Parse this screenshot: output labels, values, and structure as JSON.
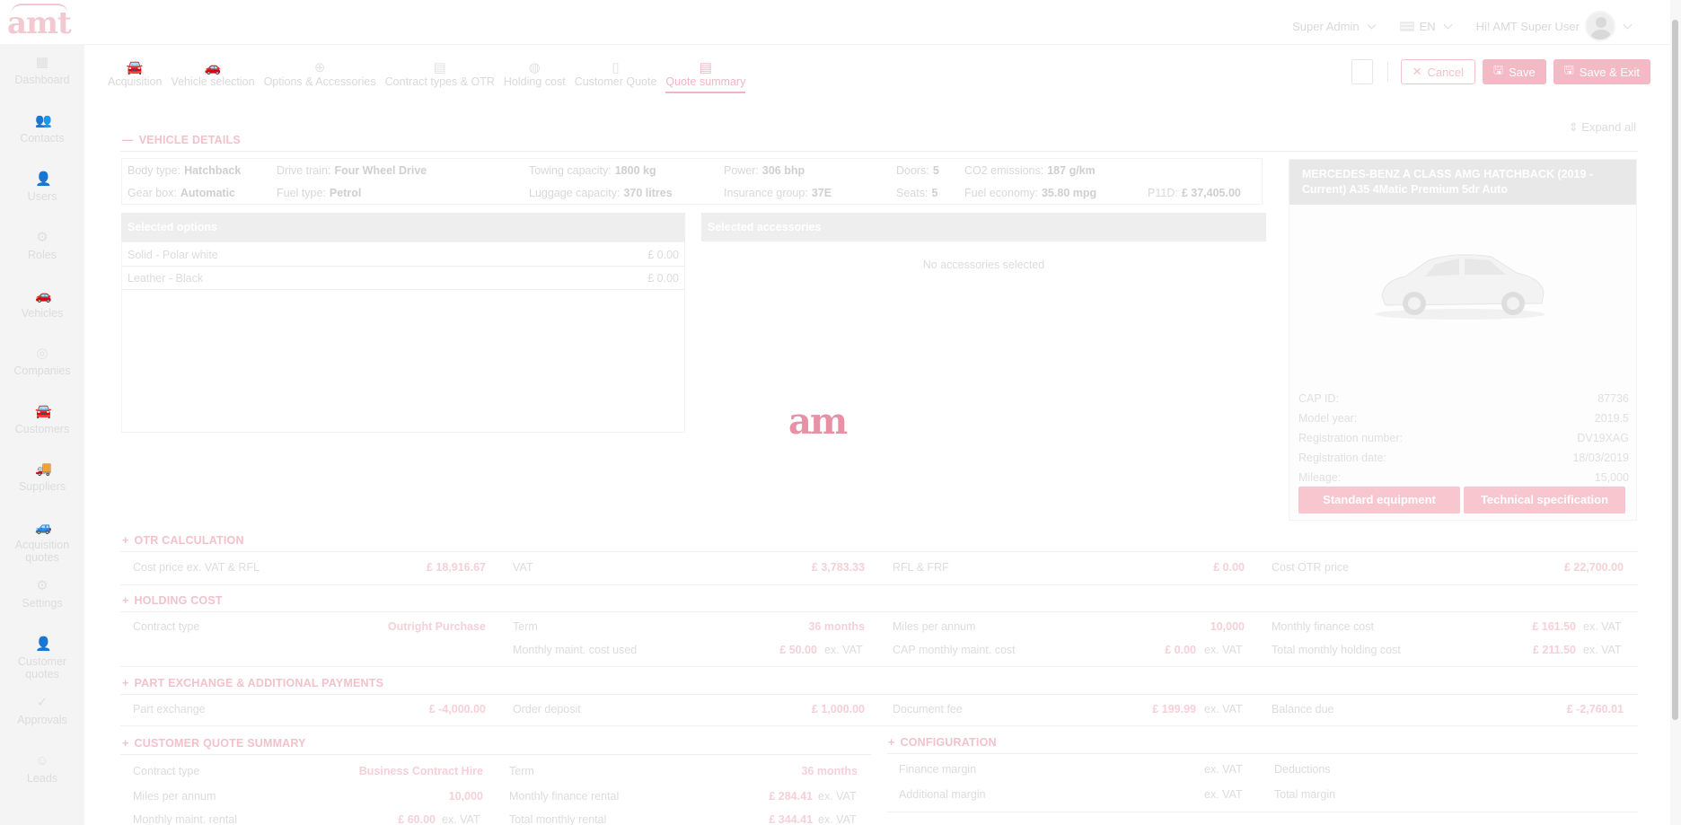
{
  "header": {
    "logo": "amt",
    "role": "Super Admin",
    "language": "EN",
    "greeting": "Hi! AMT Super User"
  },
  "sidebar": [
    {
      "label": "Dashboard",
      "icon": "dashboard-icon",
      "glyph": "▦"
    },
    {
      "label": "Contacts",
      "icon": "contacts-icon",
      "glyph": "👥"
    },
    {
      "label": "Users",
      "icon": "user-icon",
      "glyph": "👤"
    },
    {
      "label": "Roles",
      "icon": "roles-icon",
      "glyph": "⚙"
    },
    {
      "label": "Vehicles",
      "icon": "car-icon",
      "glyph": "🚗"
    },
    {
      "label": "Companies",
      "icon": "companies-icon",
      "glyph": "◎"
    },
    {
      "label": "Customers",
      "icon": "customers-icon",
      "glyph": "🚘"
    },
    {
      "label": "Suppliers",
      "icon": "suppliers-icon",
      "glyph": "🚚"
    },
    {
      "label": "Acquisition quotes",
      "icon": "acquisition-quotes-icon",
      "glyph": "🚙"
    },
    {
      "label": "Settings",
      "icon": "settings-icon",
      "glyph": "⚙"
    },
    {
      "label": "Customer quotes",
      "icon": "customer-quotes-icon",
      "glyph": "👤"
    },
    {
      "label": "Approvals",
      "icon": "approvals-icon",
      "glyph": "✓"
    },
    {
      "label": "Leads",
      "icon": "leads-icon",
      "glyph": "☺"
    }
  ],
  "tabs": [
    {
      "label": "Acquisition",
      "icon": "acquisition-icon",
      "glyph": "🚘"
    },
    {
      "label": "Vehicle selection",
      "icon": "vehicle-selection-icon",
      "glyph": "🚗"
    },
    {
      "label": "Options & Accessories",
      "icon": "options-icon",
      "glyph": "⊕"
    },
    {
      "label": "Contract types & OTR",
      "icon": "contract-icon",
      "glyph": "▤"
    },
    {
      "label": "Holding cost",
      "icon": "holding-cost-icon",
      "glyph": "◍"
    },
    {
      "label": "Customer Quote",
      "icon": "customer-quote-icon",
      "glyph": "▯"
    },
    {
      "label": "Quote summary",
      "icon": "quote-summary-icon",
      "glyph": "▤"
    }
  ],
  "actions": {
    "cancel": "Cancel",
    "save": "Save",
    "save_exit": "Save & Exit"
  },
  "expand_all": "Expand all",
  "vehicle_details": {
    "heading": "VEHICLE DETAILS",
    "specs": {
      "body_type_label": "Body type:",
      "body_type": "Hatchback",
      "drive_train_label": "Drive train:",
      "drive_train": "Four Wheel Drive",
      "towing_label": "Towing capacity:",
      "towing": "1800 kg",
      "power_label": "Power:",
      "power": "306 bhp",
      "doors_label": "Doors:",
      "doors": "5",
      "co2_label": "CO2 emissions:",
      "co2": "187 g/km",
      "gearbox_label": "Gear box:",
      "gearbox": "Automatic",
      "fuel_type_label": "Fuel type:",
      "fuel_type": "Petrol",
      "luggage_label": "Luggage capacity:",
      "luggage": "370 litres",
      "insurance_label": "Insurance group:",
      "insurance": "37E",
      "seats_label": "Seats:",
      "seats": "5",
      "economy_label": "Fuel economy:",
      "economy": "35.80 mpg",
      "p11d_label": "P11D:",
      "p11d": "£ 37,405.00"
    },
    "selected_options": {
      "heading": "Selected options",
      "items": [
        {
          "name": "Solid - Polar white",
          "price": "£ 0.00"
        },
        {
          "name": "Leather - Black",
          "price": "£ 0.00"
        }
      ]
    },
    "selected_accessories": {
      "heading": "Selected accessories",
      "empty": "No accessories selected"
    },
    "car": {
      "title": "MERCEDES-BENZ A CLASS AMG HATCHBACK (2019 - Current) A35 4Matic Premium 5dr Auto",
      "cap_id_label": "CAP ID:",
      "cap_id": "87736",
      "model_year_label": "Model year:",
      "model_year": "2019.5",
      "reg_number_label": "Registration number:",
      "reg_number": "DV19XAG",
      "reg_date_label": "Registration date:",
      "reg_date": "18/03/2019",
      "mileage_label": "Mileage:",
      "mileage": "15,000",
      "btn_standard": "Standard equipment",
      "btn_technical": "Technical specification"
    }
  },
  "loader": {
    "text": "am"
  },
  "otr": {
    "heading": "OTR CALCULATION",
    "cost_price_label": "Cost price ex. VAT & RFL",
    "cost_price": "£ 18,916.67",
    "vat_label": "VAT",
    "vat": "£ 3,783.33",
    "rfl_label": "RFL & FRF",
    "rfl": "£ 0.00",
    "cost_otr_label": "Cost OTR price",
    "cost_otr": "£ 22,700.00"
  },
  "holding": {
    "heading": "HOLDING COST",
    "contract_type_label": "Contract type",
    "contract_type": "Outright Purchase",
    "term_label": "Term",
    "term": "36 months",
    "miles_label": "Miles per annum",
    "miles": "10,000",
    "monthly_finance_label": "Monthly finance cost",
    "monthly_finance": "£ 161.50",
    "maint_used_label": "Monthly maint. cost used",
    "maint_used": "£ 50.00",
    "cap_maint_label": "CAP monthly maint. cost",
    "cap_maint": "£ 0.00",
    "total_holding_label": "Total monthly holding cost",
    "total_holding": "£ 211.50",
    "ex_vat": "ex. VAT"
  },
  "part_exchange": {
    "heading": "PART EXCHANGE & ADDITIONAL PAYMENTS",
    "px_label": "Part exchange",
    "px": "£ -4,000.00",
    "deposit_label": "Order deposit",
    "deposit": "£ 1,000.00",
    "doc_fee_label": "Document fee",
    "doc_fee": "£ 199.99",
    "balance_label": "Balance due",
    "balance": "£ -2,760.01",
    "ex_vat": "ex. VAT"
  },
  "customer_quote": {
    "heading": "CUSTOMER QUOTE SUMMARY",
    "contract_type_label": "Contract type",
    "contract_type": "Business Contract Hire",
    "term_label": "Term",
    "term": "36 months",
    "miles_label": "Miles per annum",
    "miles": "10,000",
    "finance_rental_label": "Monthly finance rental",
    "finance_rental": "£ 284.41",
    "maint_rental_label": "Monthly maint. rental",
    "maint_rental": "£ 60.00",
    "total_rental_label": "Total monthly rental",
    "total_rental": "£ 344.41",
    "ex_vat": "ex. VAT"
  },
  "configuration": {
    "heading": "CONFIGURATION",
    "finance_margin_label": "Finance margin",
    "additional_margin_label": "Additional margin",
    "deductions_label": "Deductions",
    "total_margin_label": "Total margin",
    "ex_vat": "ex. VAT"
  },
  "colors": {
    "accent": "#d6174a",
    "sidebar": "#f4f4f4"
  }
}
